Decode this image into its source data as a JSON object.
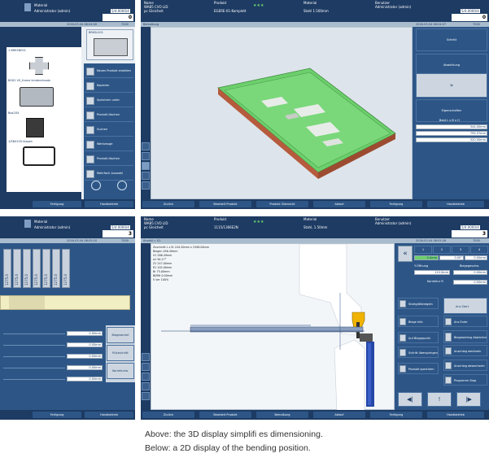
{
  "panel_top_left": {
    "header": {
      "material_label": "Material",
      "operator": "Administrator (admin)",
      "value": "5/4.0000/4",
      "counter": "0"
    },
    "strip": {
      "datetime": "2016-03-04 08:04:00",
      "code": "7000"
    },
    "thumbnails": [
      {
        "label": "1 BRKSN001"
      },
      {
        "label": "BOX2 VS_frame kindereinsatz"
      },
      {
        "label": "Box20X"
      },
      {
        "label": "1/SB4105-klagen"
      }
    ],
    "top_thumb_label": "BRKSL001",
    "menu": [
      {
        "label": "Neues Produkt erstellen"
      },
      {
        "label": "Kopieren"
      },
      {
        "label": "Speichern unter"
      },
      {
        "label": "Produkt löschen"
      },
      {
        "label": "Suchen"
      },
      {
        "label": "Werkzeuge"
      },
      {
        "label": "Produkt löschen"
      },
      {
        "label": "Mehrfach Auswahl"
      }
    ],
    "bottom": {
      "b1": "Fertigung",
      "b2": "Handbetrieb"
    }
  },
  "panel_top_right": {
    "header": {
      "name_label": "Name",
      "name_value": "WAB5 CVO LID",
      "name_sub": "pc Gleicheit",
      "product_label": "Produkt",
      "product_value": "EGERE-01-Komplett",
      "stars": "★★★",
      "material_label": "Material",
      "material_value": "Stahl 1.500mm",
      "user_label": "Benutzer",
      "user_value": "Administrator (admin)",
      "value": "5/4.0000/4",
      "counter": "0"
    },
    "strip": {
      "left": "Bemaßung",
      "datetime": "2016-03-04 08:04:07",
      "code": "7000"
    },
    "side_buttons": [
      {
        "label": "Schnitt"
      },
      {
        "label": "Abwicklung"
      },
      {
        "label": "»"
      },
      {
        "label": "Eigenschaften"
      }
    ],
    "info_title": "Beat L x B x H",
    "info_rows": [
      "344.00mm",
      "795.57mm",
      "520.00mm"
    ],
    "bottom": {
      "b1": "Zurück",
      "b2": "Bearbeit Produkt",
      "b3": "Produkt Übersicht",
      "b4": "Ablauf",
      "b5": "Fertigung",
      "b6": "Handbetrieb"
    }
  },
  "panel_bottom_left": {
    "header": {
      "material_label": "Material",
      "operator": "Administrator (admin)",
      "value": "5/4.0000/4",
      "counter": "3"
    },
    "strip": {
      "datetime": "2016-03-04 08:05:20",
      "code": "7000"
    },
    "bars": [
      "1275.0",
      "1275.0",
      "1275.0",
      "1275.0",
      "1275.0",
      "1275.0",
      "1275.0"
    ],
    "fields": [
      "0.00mm",
      "0.00mm",
      "0.00mm",
      "0.00mm",
      "0.00mm"
    ],
    "buttons": [
      {
        "label": "Biegewinkel"
      },
      {
        "label": "Rückschritt"
      },
      {
        "label": "Korrekturw."
      }
    ],
    "bottom": {
      "b1": "Fertigung",
      "b2": "Handbetrieb"
    }
  },
  "panel_bottom_right": {
    "header": {
      "name_label": "Name",
      "name_value": "WAB5 CVO LID",
      "name_sub": "pc Gleicheit",
      "product_label": "Produkt",
      "product_value": "1115/1366E2N",
      "stars": "★★★",
      "material_label": "Material",
      "material_value": "Stahl, 1.50mm",
      "user_label": "Benutzer",
      "user_value": "Administrator (admin)",
      "value": "5/4.0000/4",
      "counter": "3"
    },
    "strip": {
      "left": "Anzahl = 01",
      "datetime": "2016-03-04 08:05:26",
      "code": "7000"
    },
    "info_lines": [
      "Zuschnitt L x B: 244.30mm x 1598.00mm",
      "Biegen    456.49mm",
      "X1      266.49mm",
      "α1      90.17°",
      "Z1      247.00mm",
      "R1      102.00mm",
      "Br      75.00mm",
      "Bf/BH   0.00mm",
      "V ver   100%"
    ],
    "right_top": {
      "tabs": [
        "1",
        "2",
        "3",
        "4"
      ],
      "values": [
        "0.0mm",
        "0.00°",
        "0.00mm"
      ],
      "label1": "Y-Öffnung",
      "label2": "Biegegeschw.",
      "field1": "110.0mm",
      "field2": "0.00mm",
      "label3": "Korrektur R"
    },
    "right_buttons": [
      {
        "label": "Startgrößeregeln"
      },
      {
        "label": "Biege info"
      },
      {
        "label": "Auf Biegepunkt"
      },
      {
        "label": "Schritt überspringen"
      },
      {
        "label": "Produkt speichern"
      },
      {
        "label": "Ans Start"
      },
      {
        "label": "Ans Ende"
      },
      {
        "label": "Biegeanfang Abwicklung"
      },
      {
        "label": "Anschlag wechseln"
      },
      {
        "label": "Anschlag abwechseln"
      },
      {
        "label": "Programm Stop"
      }
    ],
    "nav": {
      "first": "◀|",
      "mid": "!",
      "last": "|▶"
    },
    "bottom": {
      "b1": "Zurück",
      "b2": "Bearbeit Produkt",
      "b3": "Bemaßung",
      "b4": "Ablauf",
      "b5": "Fertigung",
      "b6": "Handbetrieb"
    }
  },
  "caption": {
    "line1": "Above: the 3D display simplifi es dimensioning.",
    "line2": "Below: a 2D display of the bending position."
  }
}
